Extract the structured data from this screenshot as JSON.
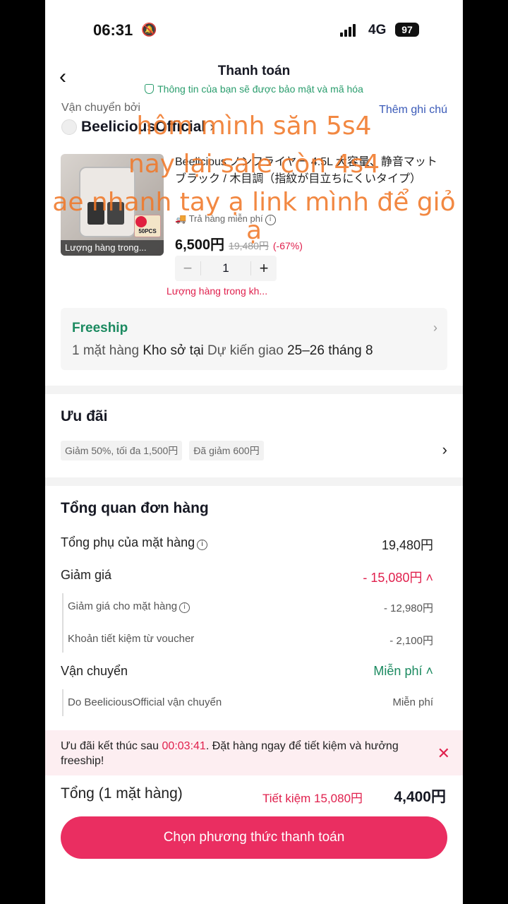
{
  "status": {
    "time": "06:31",
    "network": "4G",
    "battery": "97"
  },
  "header": {
    "title": "Thanh toán",
    "secure_note": "Thông tin của bạn sẽ được bảo mật và mã hóa"
  },
  "seller": {
    "ship_by": "Vận chuyển bởi",
    "name": "BeeliciousOfficial",
    "add_note": "Thêm ghi chú"
  },
  "product": {
    "title": "Beelicious ノンフライヤー 4.5L 大容量、静音マットブラック / 木目調（指紋が目立ちにくいタイプ）",
    "badge": "50PCS",
    "stock_overlay": "Lượng hàng trong...",
    "free_return": "Trả hàng miễn phí",
    "price": "6,500円",
    "old_price": "19,480円",
    "discount": "(-67%)",
    "qty": "1",
    "low_stock": "Lượng hàng trong kh..."
  },
  "freeship": {
    "label": "Freeship",
    "line_prefix": "1 mặt hàng",
    "line_mid": "Kho sở tại",
    "line_suffix": "Dự kiến giao",
    "eta": "25–26 tháng 8"
  },
  "deals": {
    "title": "Ưu đãi",
    "chips": [
      "Giảm 50%, tối đa 1,500円",
      "Đã giảm 600円"
    ]
  },
  "overview": {
    "title": "Tổng quan đơn hàng",
    "subtotal_label": "Tổng phụ của mặt hàng",
    "subtotal": "19,480円",
    "discount_label": "Giảm giá",
    "discount": "- 15,080円",
    "item_discount_label": "Giảm giá cho mặt hàng",
    "item_discount": "- 12,980円",
    "voucher_label": "Khoản tiết kiệm từ voucher",
    "voucher": "- 2,100円",
    "shipping_label": "Vận chuyển",
    "shipping": "Miễn phí",
    "ship_by_label": "Do BeeliciousOfficial vận chuyển",
    "ship_by_value": "Miễn phí"
  },
  "banner": {
    "prefix": "Ưu đãi kết thúc sau",
    "timer": "00:03:41",
    "suffix": ". Đặt hàng ngay để tiết kiệm và hưởng freeship!"
  },
  "footer": {
    "total_label": "Tổng (1 mặt hàng)",
    "savings": "Tiết kiệm 15,080円",
    "total": "4,400円",
    "pay_button": "Chọn phương thức thanh toán"
  },
  "caption": [
    "hôm mình săn 5s4",
    "nay lại sale còn 4s4",
    "ae nhanh tay ạ link mình để giỏ",
    "ạ"
  ]
}
